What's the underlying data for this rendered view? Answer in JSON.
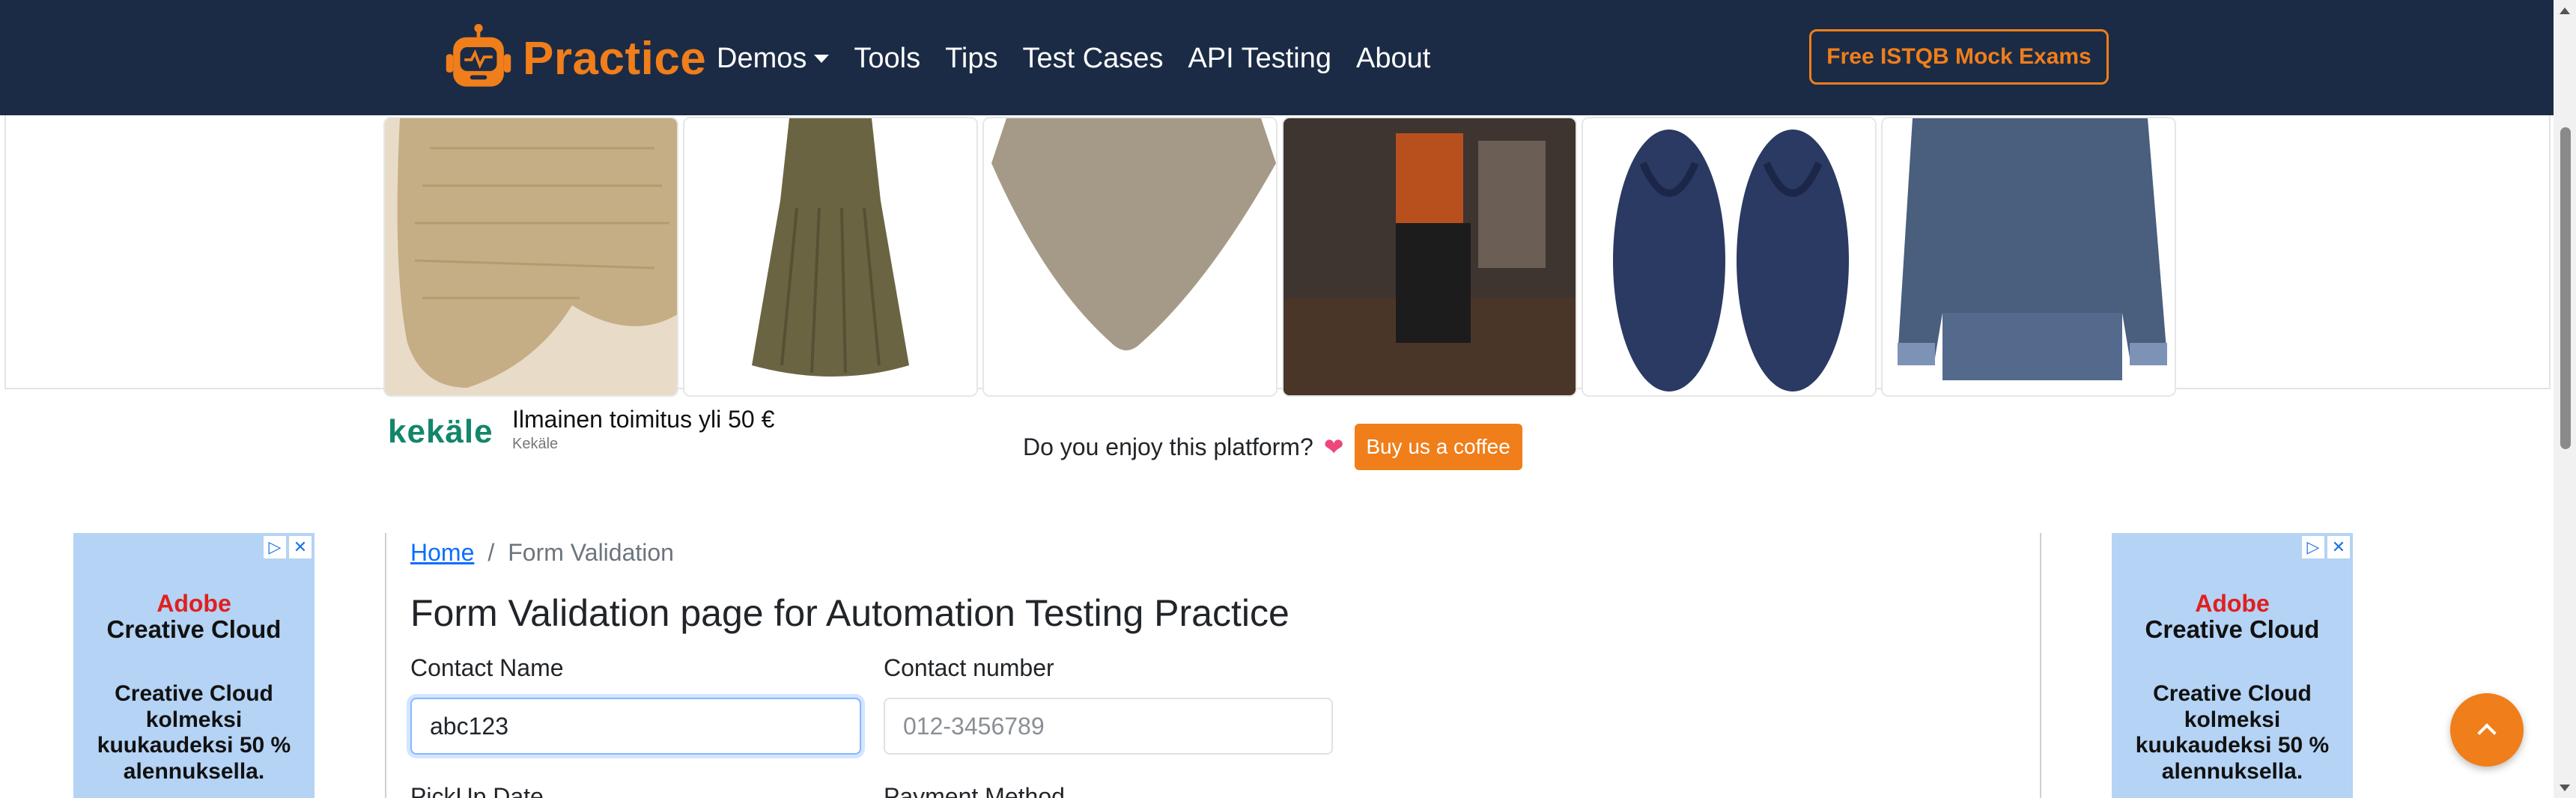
{
  "navbar": {
    "brand": "Practice",
    "links": [
      "Demos",
      "Tools",
      "Tips",
      "Test Cases",
      "API Testing",
      "About"
    ],
    "cta": "Free ISTQB Mock Exams"
  },
  "top_ad": {
    "brand": "kekäle",
    "headline": "Ilmainen toimitus yli 50 €",
    "source": "Kekäle"
  },
  "coffee": {
    "text": "Do you enjoy this platform?",
    "button": "Buy us a coffee"
  },
  "side_ad": {
    "logo": "Adobe",
    "product": "Creative Cloud",
    "copy": "Creative Cloud kolmeksi kuukaudeksi 50 % alennuksella."
  },
  "breadcrumb": {
    "home": "Home",
    "separator": "/",
    "current": "Form Validation"
  },
  "page_title": "Form Validation page for Automation Testing Practice",
  "form": {
    "contact_name": {
      "label": "Contact Name",
      "value": "abc123"
    },
    "contact_number": {
      "label": "Contact number",
      "placeholder": "012-3456789"
    },
    "pickup_date": {
      "label": "PickUp Date"
    },
    "payment_method": {
      "label": "Payment Method"
    }
  },
  "colors": {
    "navbar_bg": "#1b2b45",
    "accent": "#f07e1a",
    "link": "#0d6efd",
    "ad_bg": "#b4d3f5"
  }
}
